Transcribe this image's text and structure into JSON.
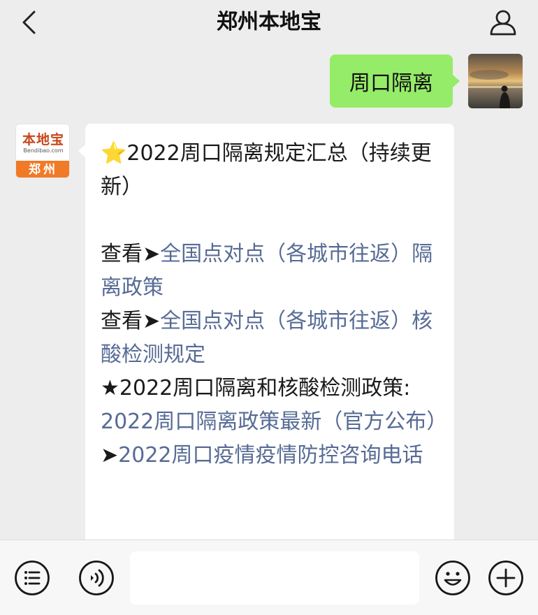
{
  "header": {
    "title": "郑州本地宝",
    "back_icon": "chevron-left-icon",
    "profile_icon": "person-icon"
  },
  "user_message": {
    "text": "周口隔离"
  },
  "bot": {
    "avatar": {
      "brand_cn": "本地宝",
      "brand_en": "Bendibao.com",
      "city": "郑州"
    },
    "message": {
      "line1": "⭐2022周口隔离规定汇总（持续更新）",
      "view_prefix": "查看➤",
      "link1": "全国点对点（各城市往返）隔离政策",
      "link2": "全国点对点（各城市往返）核酸检测规定",
      "section_title": "★2022周口隔离和核酸检测政策:",
      "link3": "2022周口隔离政策最新（官方公布）",
      "arrow": "➤",
      "link4": "2022周口疫情疫情防控咨询电话"
    }
  },
  "input_bar": {
    "list_icon": "list-icon",
    "voice_icon": "voice-icon",
    "emoji_icon": "emoji-icon",
    "plus_icon": "plus-icon",
    "input_value": ""
  },
  "colors": {
    "background": "#ededed",
    "user_bubble": "#95ec69",
    "link": "#576b95",
    "logo_orange": "#f07a28"
  }
}
